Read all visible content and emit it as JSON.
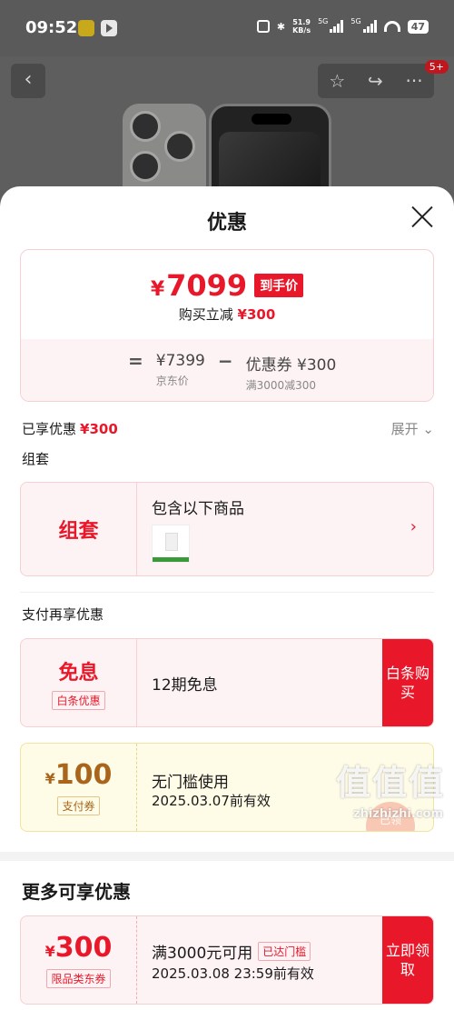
{
  "status_bar": {
    "time": "09:52",
    "net_speed": "51.9",
    "net_unit": "KB/s",
    "signal1": "5G",
    "signal2": "5G",
    "battery": "47"
  },
  "top_nav": {
    "back_icon": "chevron-left-icon",
    "badge": "5+"
  },
  "sheet": {
    "title": "优惠"
  },
  "price_card": {
    "currency": "¥",
    "final_price": "7099",
    "price_tag": "到手价",
    "discount_prefix": "购买立减",
    "discount_value": "¥300",
    "equals": "=",
    "jd_price": "¥7399",
    "jd_price_label": "京东价",
    "minus": "−",
    "coupon_price": "优惠券 ¥300",
    "coupon_label": "满3000减300"
  },
  "enjoyed": {
    "label": "已享优惠",
    "value": "¥300",
    "expand": "展开 ⌄"
  },
  "combo_section": {
    "label": "组套",
    "left": "组套",
    "title": "包含以下商品"
  },
  "pay_section": {
    "label": "支付再享优惠",
    "mianxi_big": "免息",
    "mianxi_tag": "白条优惠",
    "mianxi_text": "12期免息",
    "mianxi_btn": "白条购买",
    "coupon_currency": "¥",
    "coupon_value": "100",
    "coupon_tag": "支付券",
    "coupon_line1": "无门槛使用",
    "coupon_line2": "2025.03.07前有效",
    "coupon_stamp": "已领"
  },
  "more_section": {
    "title": "更多可享优惠",
    "coupon_currency": "¥",
    "coupon_value": "300",
    "coupon_tag": "限品类东券",
    "line1": "满3000元可用",
    "line1_badge": "已达门槛",
    "line2": "2025.03.08 23:59前有效",
    "button": "立即领取"
  },
  "watermark": {
    "text": "值值值",
    "url": "zhizhizhi.com"
  }
}
